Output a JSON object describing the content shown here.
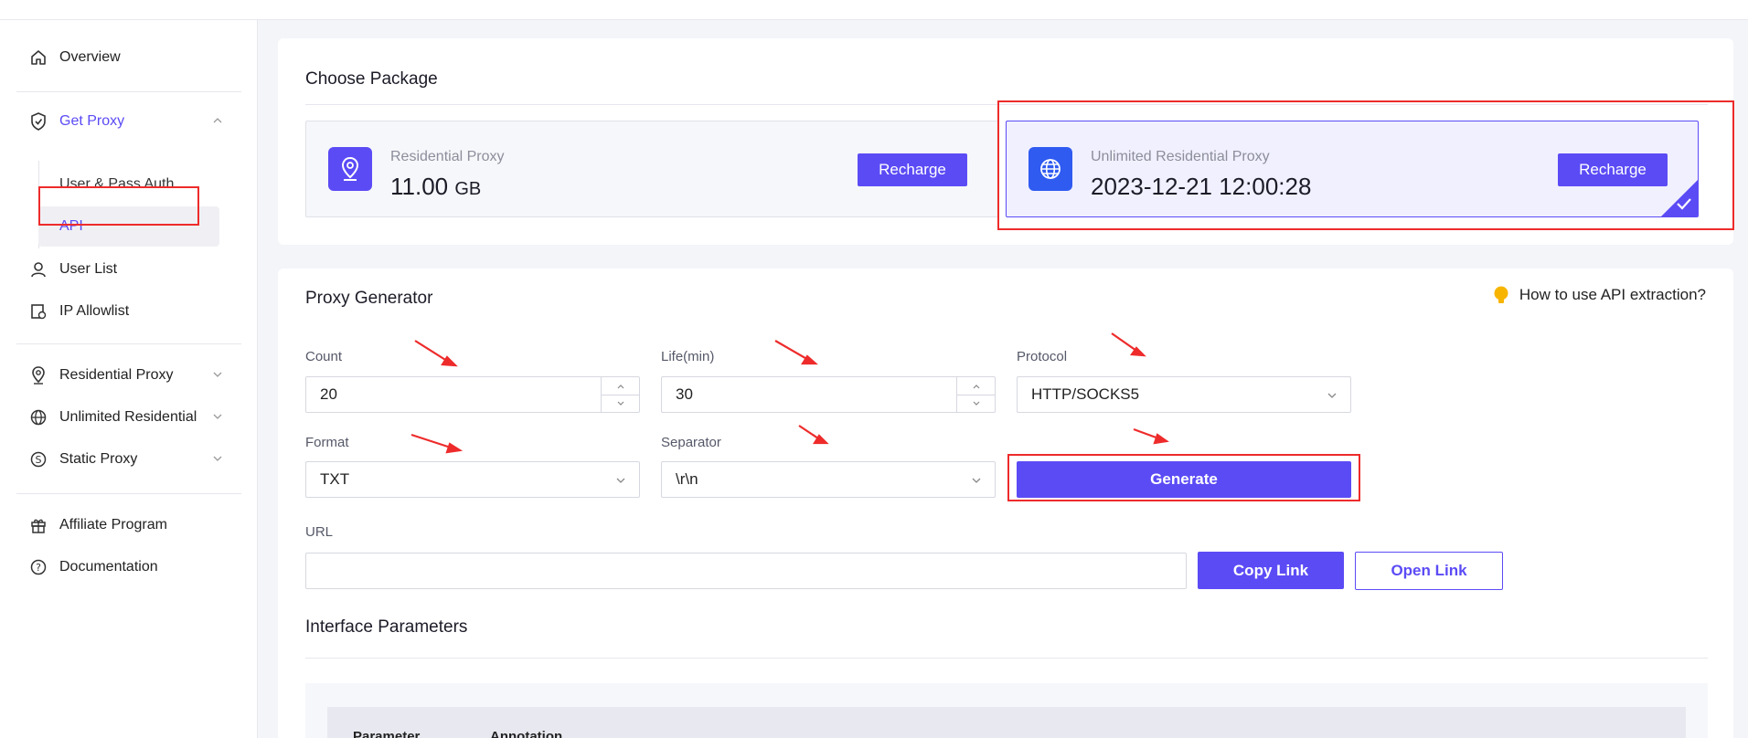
{
  "sidebar": {
    "items": [
      {
        "label": "Overview",
        "icon": "home-icon"
      },
      {
        "label": "Get Proxy",
        "icon": "shield-check-icon"
      },
      {
        "label": "User List",
        "icon": "user-icon"
      },
      {
        "label": "IP Allowlist",
        "icon": "allowlist-icon"
      },
      {
        "label": "Residential Proxy",
        "icon": "location-pin-icon"
      },
      {
        "label": "Unlimited Residential",
        "icon": "globe-icon"
      },
      {
        "label": "Static Proxy",
        "icon": "dollar-circle-icon"
      },
      {
        "label": "Affiliate Program",
        "icon": "gift-icon"
      },
      {
        "label": "Documentation",
        "icon": "question-circle-icon"
      }
    ],
    "get_proxy_sub": [
      {
        "label": "User & Pass Auth"
      },
      {
        "label": "API"
      }
    ]
  },
  "choose_package": {
    "title": "Choose Package",
    "packages": [
      {
        "title": "Residential Proxy",
        "value": "11.00",
        "unit": "GB",
        "button": "Recharge"
      },
      {
        "title": "Unlimited Residential Proxy",
        "value": "2023-12-21 12:00:28",
        "unit": "",
        "button": "Recharge",
        "selected": true
      }
    ]
  },
  "generator": {
    "title": "Proxy Generator",
    "help_link": "How to use API extraction?",
    "count_label": "Count",
    "count_value": "20",
    "life_label": "Life(min)",
    "life_value": "30",
    "protocol_label": "Protocol",
    "protocol_value": "HTTP/SOCKS5",
    "format_label": "Format",
    "format_value": "TXT",
    "separator_label": "Separator",
    "separator_value": "\\r\\n",
    "generate_button": "Generate",
    "url_label": "URL",
    "url_value": "",
    "copy_button": "Copy Link",
    "open_button": "Open Link"
  },
  "interface_params": {
    "title": "Interface Parameters",
    "columns": [
      "Parameter",
      "Annotation"
    ]
  },
  "colors": {
    "accent": "#5b4bf5",
    "globe_badge": "#2f5bf1",
    "annotation_red": "#ee2b2b",
    "help_bulb": "#f7b500"
  }
}
